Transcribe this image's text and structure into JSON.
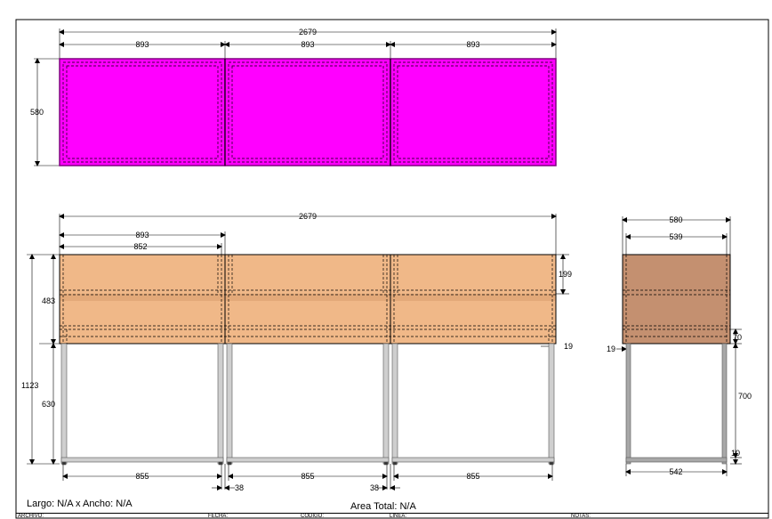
{
  "colors": {
    "panel_top": "#ff00ff",
    "panel_top_border": "#800080",
    "wood": "#f0b888",
    "wood_dark": "#d99d6e",
    "side_wood": "#c49070",
    "metal": "#cfcfcf"
  },
  "plan_view": {
    "total_width": "2679",
    "module_widths": [
      "893",
      "893",
      "893"
    ],
    "depth": "580"
  },
  "front_view": {
    "total_width": "2679",
    "module_width": "893",
    "inner_width": "852",
    "drawer_height": "199",
    "cabinet_height": "483",
    "total_height": "1123",
    "leg_height": "630",
    "panel_thickness": "19",
    "leg_spans": [
      "855",
      "855",
      "855"
    ],
    "leg_gaps": [
      "38",
      "38"
    ]
  },
  "side_view": {
    "outer_width": "580",
    "inner_width": "539",
    "panel_thickness": "19",
    "apron_height": "70",
    "leg_height": "700",
    "rail_height": "10",
    "base_width": "542"
  },
  "footer": {
    "size_text": "Largo: N/A x Ancho: N/A",
    "area_text": "Area Total: N/A",
    "title_block": [
      "ARCHIVO:",
      "FECHA:",
      "CODIGO:",
      "LINEA:",
      "NOTAS:"
    ]
  }
}
